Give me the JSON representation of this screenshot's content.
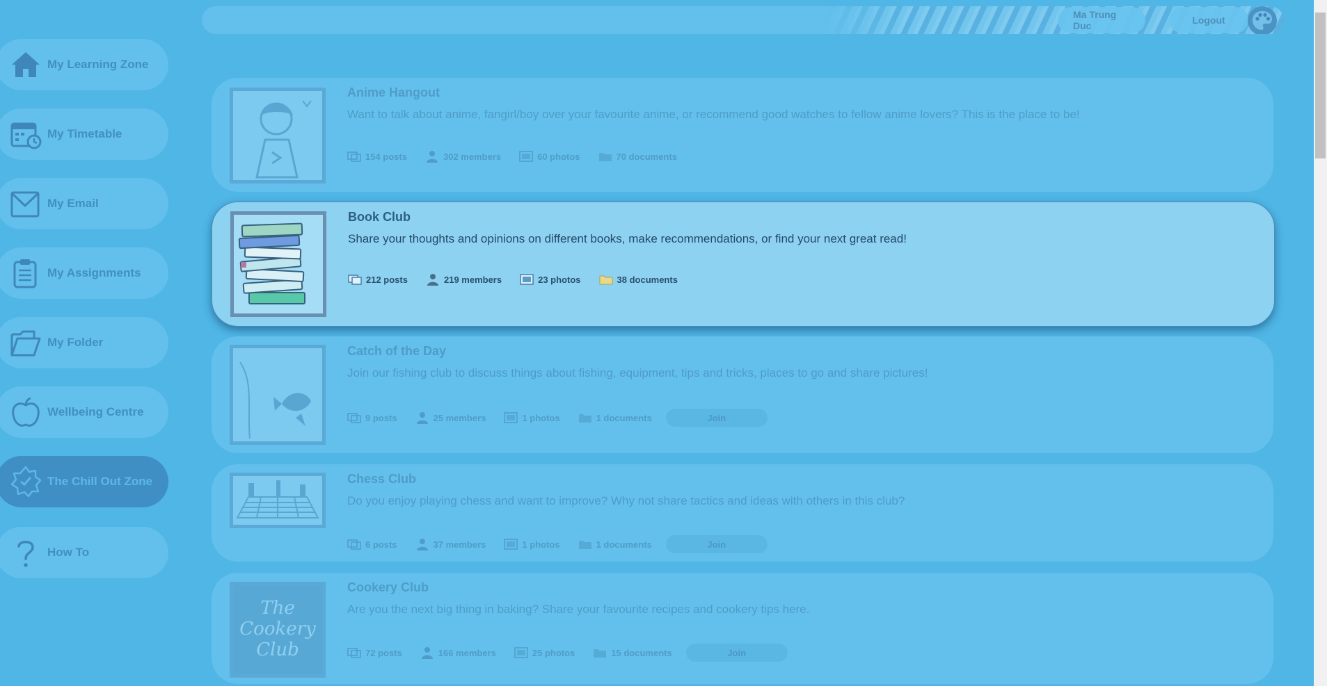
{
  "header": {
    "user_name": "Ma Trung Duc",
    "logout_label": "Logout",
    "theme_icon": "palette-icon"
  },
  "sidebar": {
    "items": [
      {
        "label": "My Learning Zone",
        "icon": "home-icon"
      },
      {
        "label": "My Timetable",
        "icon": "calendar-clock-icon"
      },
      {
        "label": "My Email",
        "icon": "envelope-icon"
      },
      {
        "label": "My Assignments",
        "icon": "clipboard-icon"
      },
      {
        "label": "My Folder",
        "icon": "folder-icon"
      },
      {
        "label": "Wellbeing Centre",
        "icon": "apple-icon"
      },
      {
        "label": "The Chill Out Zone",
        "icon": "badge-icon",
        "active": true
      },
      {
        "label": "How To",
        "icon": "question-icon"
      }
    ]
  },
  "groups": [
    {
      "title": "Anime Hangout",
      "description": "Want to talk about anime, fangirl/boy over your favourite anime, or recommend good watches to fellow anime lovers? This is the place to be!",
      "posts": "154 posts",
      "members": "302 members",
      "photos": "60 photos",
      "documents": "70 documents"
    },
    {
      "title": "Book Club",
      "description": "Share your thoughts and opinions on different books, make recommendations, or find your next great read!",
      "posts": "212 posts",
      "members": "219 members",
      "photos": "23 photos",
      "documents": "38 documents"
    },
    {
      "title": "Catch of the Day",
      "description": "Join our fishing club to discuss things about fishing, equipment, tips and tricks, places to go and share pictures!",
      "posts": "9 posts",
      "members": "25 members",
      "photos": "1 photos",
      "documents": "1 documents",
      "join_label": "Join"
    },
    {
      "title": "Chess Club",
      "description": "Do you enjoy playing chess and want to improve? Why not share tactics and ideas with others in this club?",
      "posts": "6 posts",
      "members": "37 members",
      "photos": "1 photos",
      "documents": "1 documents",
      "join_label": "Join"
    },
    {
      "title": "Cookery Club",
      "description": "Are you the next big thing in baking? Share your favourite recipes and cookery tips here.",
      "posts": "72 posts",
      "members": "166 members",
      "photos": "25 photos",
      "documents": "15 documents",
      "join_label": "Join",
      "thumb_text": [
        "The",
        "Cookery",
        "Club"
      ]
    }
  ]
}
